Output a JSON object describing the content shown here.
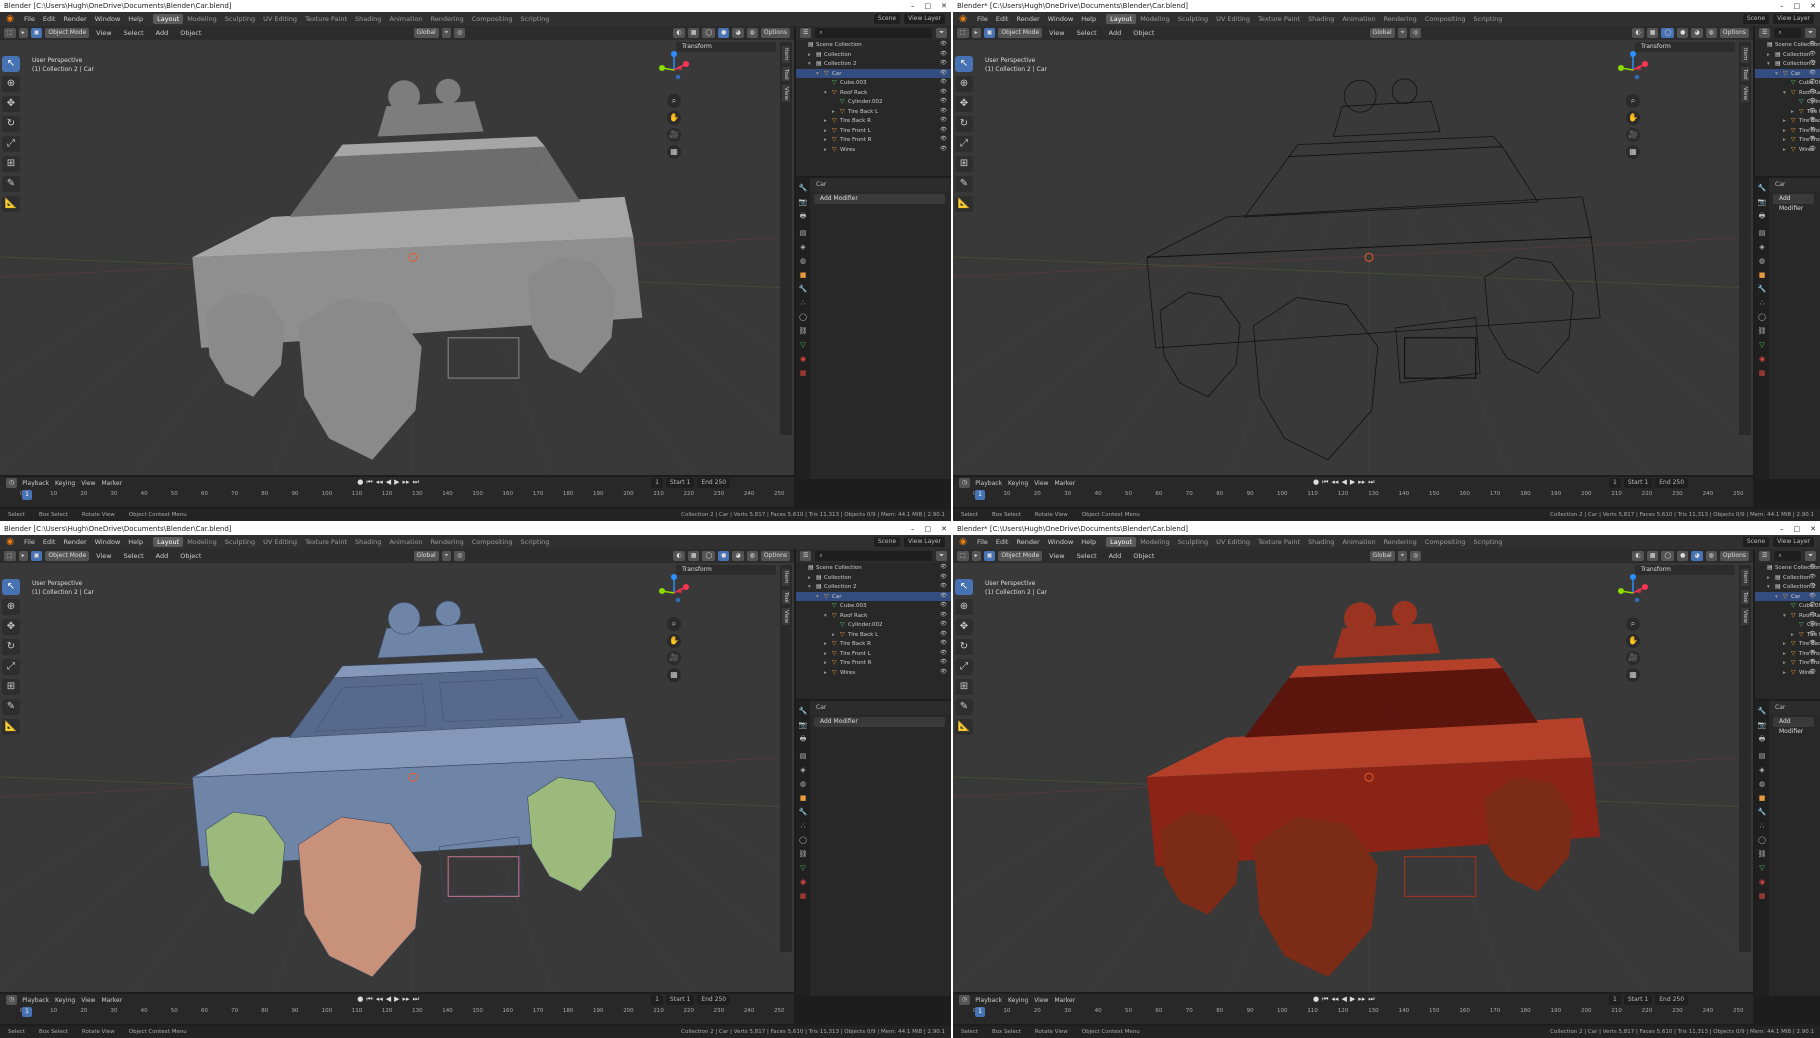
{
  "app": {
    "title": "Blender [C:\\Users\\Hugh\\OneDrive\\Documents\\Blender\\Car.blend]",
    "title_short": "Blender* [C:\\Users\\Hugh\\OneDrive\\Documents\\Blender\\Car.blend]"
  },
  "menu": [
    "File",
    "Edit",
    "Render",
    "Window",
    "Help"
  ],
  "workspaces": [
    "Layout",
    "Modeling",
    "Sculpting",
    "UV Editing",
    "Texture Paint",
    "Shading",
    "Animation",
    "Rendering",
    "Compositing",
    "Scripting"
  ],
  "scene": {
    "scene_label": "Scene",
    "view_layer_label": "View Layer"
  },
  "viewport": {
    "mode": "Object Mode",
    "menus": [
      "View",
      "Select",
      "Add",
      "Object"
    ],
    "transform_orient": "Global",
    "options_label": "Options",
    "info_line1": "User Perspective",
    "info_line2": "(1) Collection 2 | Car",
    "transform_panel": "Transform",
    "npanel_tabs": [
      "Item",
      "Tool",
      "View"
    ]
  },
  "outliner": {
    "rows": [
      {
        "label": "Scene Collection",
        "indent": 0,
        "icon": "collection",
        "expand": ""
      },
      {
        "label": "Collection",
        "indent": 1,
        "icon": "collection",
        "expand": "▸"
      },
      {
        "label": "Collection 2",
        "indent": 1,
        "icon": "collection",
        "expand": "▾"
      },
      {
        "label": "Car",
        "indent": 2,
        "icon": "object",
        "expand": "▾"
      },
      {
        "label": "Cube.003",
        "indent": 3,
        "icon": "mesh",
        "expand": ""
      },
      {
        "label": "Roof Rack",
        "indent": 3,
        "icon": "object",
        "expand": "▾"
      },
      {
        "label": "Cylinder.002",
        "indent": 4,
        "icon": "mesh",
        "expand": ""
      },
      {
        "label": "Tire Back L",
        "indent": 4,
        "icon": "object",
        "expand": "▸"
      },
      {
        "label": "Tire Back R",
        "indent": 3,
        "icon": "object",
        "expand": "▸"
      },
      {
        "label": "Tire Front L",
        "indent": 3,
        "icon": "object",
        "expand": "▸"
      },
      {
        "label": "Tire Front R",
        "indent": 3,
        "icon": "object",
        "expand": "▸"
      },
      {
        "label": "Wires",
        "indent": 3,
        "icon": "object",
        "expand": "▸"
      }
    ]
  },
  "properties": {
    "object_name": "Car",
    "add_modifier": "Add Modifier"
  },
  "timeline": {
    "menus": [
      "Playback",
      "Keying",
      "View",
      "Marker"
    ],
    "current_frame": "1",
    "start_label": "Start",
    "start_value": "1",
    "end_label": "End",
    "end_value": "250",
    "ruler": [
      "0",
      "10",
      "20",
      "30",
      "40",
      "50",
      "60",
      "70",
      "80",
      "90",
      "100",
      "110",
      "120",
      "130",
      "140",
      "150",
      "160",
      "170",
      "180",
      "190",
      "200",
      "210",
      "220",
      "230",
      "240",
      "250"
    ]
  },
  "statusbar": {
    "items": [
      "Select",
      "Box Select",
      "Rotate View",
      "Object Context Menu"
    ],
    "stats": "Collection 2 | Car | Verts 5,817 | Faces 5,610 | Tris 11,313 | Objects 0/9 | Mem: 44.1 MiB | 2.90.1"
  },
  "colors": {
    "accent": "#4772b3",
    "solid_car": "#8f8f8f",
    "blue_car": "#6f85a8",
    "red_car": "#8a2416",
    "wheel_peach": "#c8917a",
    "wheel_green": "#9cba7c"
  }
}
